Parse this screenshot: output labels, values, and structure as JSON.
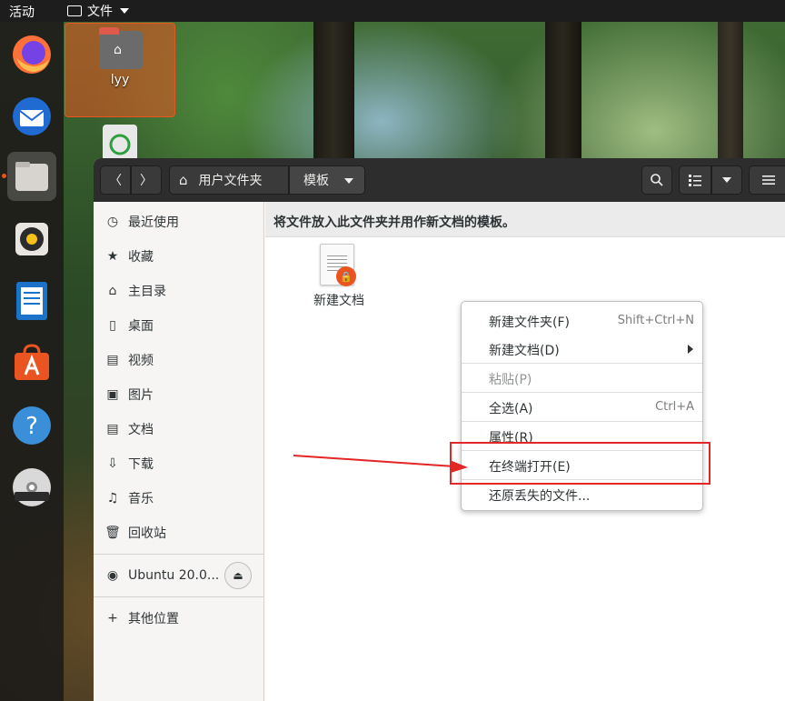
{
  "topbar": {
    "activities": "活动",
    "app_name": "文件"
  },
  "desktop": {
    "home_label": "lyy"
  },
  "headerbar": {
    "path": [
      "用户文件夹",
      "模板"
    ]
  },
  "sidebar": {
    "items": [
      {
        "label": "最近使用",
        "icon": "clock-icon"
      },
      {
        "label": "收藏",
        "icon": "star-icon"
      },
      {
        "label": "主目录",
        "icon": "home-icon"
      },
      {
        "label": "桌面",
        "icon": "desktop-icon"
      },
      {
        "label": "视频",
        "icon": "video-icon"
      },
      {
        "label": "图片",
        "icon": "picture-icon"
      },
      {
        "label": "文档",
        "icon": "document-icon"
      },
      {
        "label": "下载",
        "icon": "download-icon"
      },
      {
        "label": "音乐",
        "icon": "music-icon"
      },
      {
        "label": "回收站",
        "icon": "trash-icon"
      }
    ],
    "device": "Ubuntu 20.0...",
    "other": "其他位置"
  },
  "content": {
    "info": "将文件放入此文件夹并用作新文档的模板。",
    "file_label": "新建文档"
  },
  "context_menu": {
    "items": [
      {
        "label": "新建文件夹(F)",
        "shortcut": "Shift+Ctrl+N"
      },
      {
        "label": "新建文档(D)",
        "shortcut": ""
      },
      {
        "label": "粘贴(P)",
        "shortcut": ""
      },
      {
        "label": "全选(A)",
        "shortcut": "Ctrl+A"
      },
      {
        "label": "属性(R)",
        "shortcut": ""
      },
      {
        "label": "在终端打开(E)",
        "shortcut": ""
      },
      {
        "label": "还原丢失的文件...",
        "shortcut": ""
      }
    ]
  },
  "colors": {
    "accent": "#e95420",
    "annotation": "#e32626"
  }
}
